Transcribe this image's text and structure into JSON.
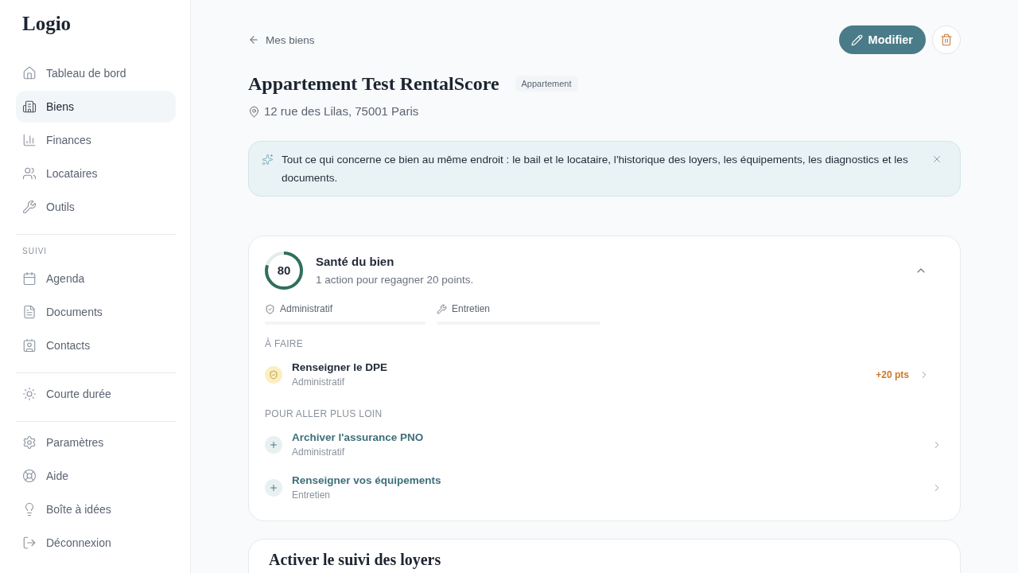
{
  "sidebar": {
    "logo": "Logio",
    "sections": [
      {
        "items": [
          {
            "label": "Tableau de bord",
            "selected": false
          },
          {
            "label": "Biens",
            "selected": true
          },
          {
            "label": "Finances",
            "selected": false
          },
          {
            "label": "Locataires",
            "selected": false
          },
          {
            "label": "Outils",
            "selected": false
          }
        ]
      },
      {
        "heading": "SUIVI",
        "items": [
          {
            "label": "Agenda",
            "selected": false
          },
          {
            "label": "Documents",
            "selected": false
          },
          {
            "label": "Contacts",
            "selected": false
          }
        ]
      },
      {
        "items": [
          {
            "label": "Courte durée",
            "selected": false
          }
        ]
      },
      {
        "items": [
          {
            "label": "Paramètres",
            "selected": false
          },
          {
            "label": "Aide",
            "selected": false
          },
          {
            "label": "Boîte à idées",
            "selected": false
          },
          {
            "label": "Déconnexion",
            "selected": false
          }
        ]
      }
    ]
  },
  "header": {
    "back_link": "Mes biens",
    "edit_button": "Modifier",
    "title": "Appartement Test RentalScore",
    "type_badge": "Appartement",
    "address": "12 rue des Lilas, 75001 Paris"
  },
  "info_banner": {
    "text": "Tout ce qui concerne ce bien au même endroit : le bail et le locataire, l'historique des loyers, les équipements, les diagnostics et les documents."
  },
  "health_card": {
    "expanded": true,
    "score": "80",
    "level": 0.8,
    "title": "Santé du bien",
    "subtitle": "1 action pour regagner 20 points.",
    "categories": [
      {
        "label": "Administratif",
        "level": 0
      },
      {
        "label": "Entretien",
        "level": 0
      }
    ],
    "sections": [
      {
        "kind": "todo",
        "heading": "À FAIRE",
        "items": [
          {
            "title": "Renseigner le DPE",
            "category": "Administratif",
            "points": "+20 pts"
          }
        ]
      },
      {
        "kind": "suggestion",
        "heading": "POUR ALLER PLUS LOIN",
        "items": [
          {
            "title": "Archiver l'assurance PNO",
            "category": "Administratif"
          },
          {
            "title": "Renseigner vos équipements",
            "category": "Entretien"
          }
        ]
      }
    ]
  },
  "next_card": {
    "title": "Activer le suivi des loyers"
  }
}
